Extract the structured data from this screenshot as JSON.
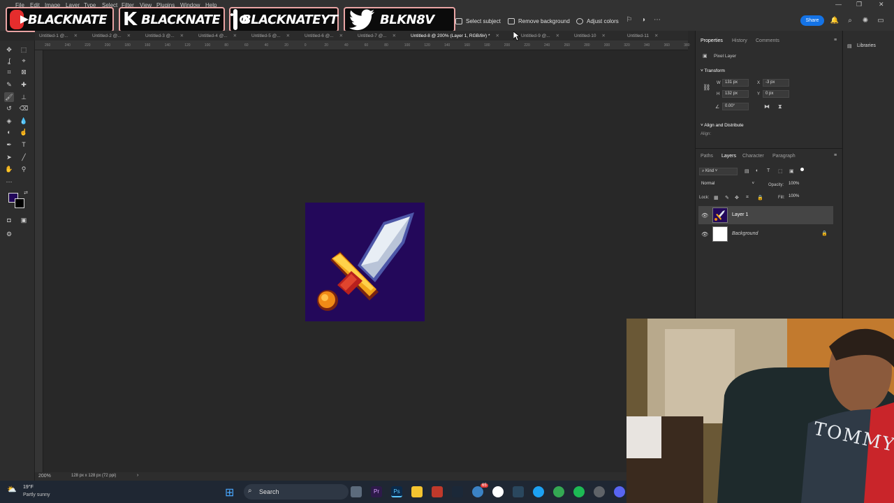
{
  "menu": [
    "File",
    "Edit",
    "Image",
    "Layer",
    "Type",
    "Select",
    "Filter",
    "View",
    "Plugins",
    "Window",
    "Help"
  ],
  "social": {
    "youtube_handle": "BLACKNATE",
    "kick_handle": "BLACKNATE",
    "instagram_handle": "BLACKNATEYT",
    "twitter_handle": "BLKN8V"
  },
  "contextual_bar": {
    "select_subject": "Select subject",
    "remove_background": "Remove background",
    "adjust_colors": "Adjust colors",
    "share": "Share"
  },
  "tabs": [
    {
      "label": "Untitled-1 @..."
    },
    {
      "label": "Untitled-2 @..."
    },
    {
      "label": "Untitled-3 @..."
    },
    {
      "label": "Untitled-4 @..."
    },
    {
      "label": "Untitled-5 @..."
    },
    {
      "label": "Untitled-6 @..."
    },
    {
      "label": "Untitled-7 @..."
    },
    {
      "label": "Untitled-8 @ 200% (Layer 1, RGB/8#) *"
    },
    {
      "label": "Untitled-9 @..."
    },
    {
      "label": "Untitled-10"
    },
    {
      "label": "Untitled-11"
    }
  ],
  "ruler_top": [
    "260",
    "240",
    "220",
    "200",
    "180",
    "160",
    "140",
    "120",
    "100",
    "80",
    "60",
    "40",
    "20",
    "0",
    "20",
    "40",
    "60",
    "80",
    "100",
    "120",
    "140",
    "160",
    "180",
    "200",
    "220",
    "240",
    "260",
    "280",
    "300",
    "320",
    "340",
    "360",
    "380"
  ],
  "status": {
    "zoom": "200%",
    "doc_info": "128 px x 128 px (72 ppi)"
  },
  "colors": {
    "foreground": "#23085a",
    "background": "#000000",
    "canvas_bg": "#23085a",
    "accent": "#1473e6"
  },
  "properties": {
    "tabs": [
      "Properties",
      "History",
      "Comments"
    ],
    "layer_type": "Pixel Layer",
    "transform_title": "Transform",
    "w": "131 px",
    "h": "132 px",
    "x": "-3 px",
    "y": "0 px",
    "angle": "0.00°",
    "align_title": "Align and Distribute",
    "align_label": "Align:"
  },
  "layers_panel": {
    "tabs": [
      "Paths",
      "Layers",
      "Character",
      "Paragraph"
    ],
    "filter_kind": "Kind",
    "blend_mode": "Normal",
    "opacity_label": "Opacity:",
    "opacity": "100%",
    "lock_label": "Lock:",
    "fill_label": "Fill:",
    "fill": "100%",
    "layers": [
      {
        "name": "Layer 1"
      },
      {
        "name": "Background"
      }
    ]
  },
  "libraries": "Libraries",
  "taskbar": {
    "weather_temp": "19°F",
    "weather_desc": "Partly sunny",
    "search": "Search",
    "notification_count": "65"
  },
  "webcam_shirt_text": "TOMMY HILFIGER"
}
